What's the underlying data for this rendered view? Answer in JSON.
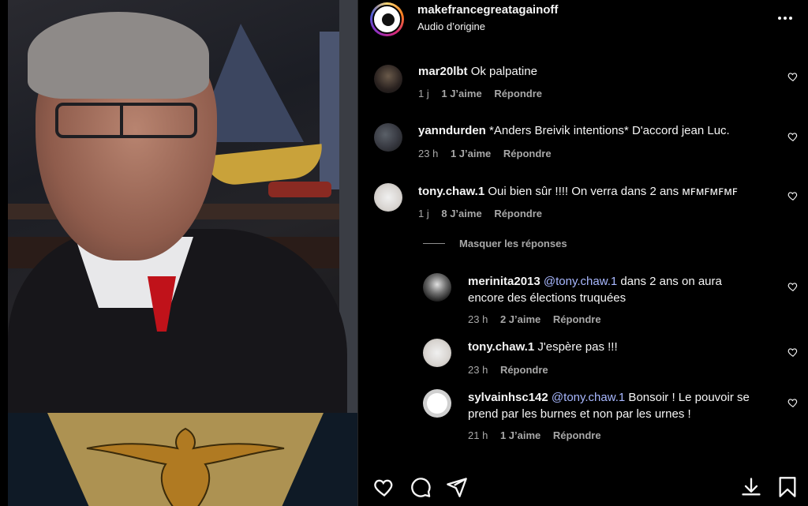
{
  "post": {
    "username": "makefrancegreatagainoff",
    "audio": "Audio d’origine"
  },
  "comments": [
    {
      "username": "mar20lbt",
      "text": "Ok palpatine",
      "time": "1 j",
      "likes": "1 J’aime",
      "reply": "Répondre"
    },
    {
      "username": "yanndurden",
      "text": "*Anders Breivik intentions* D'accord jean Luc.",
      "time": "23 h",
      "likes": "1 J’aime",
      "reply": "Répondre"
    },
    {
      "username": "tony.chaw.1",
      "text": "Oui bien sûr !!!! On verra dans 2 ans ᴍꜰᴍꜰᴍꜰᴍꜰ",
      "time": "1 j",
      "likes": "8 J’aime",
      "reply": "Répondre"
    }
  ],
  "hide_replies_label": "Masquer les réponses",
  "replies": [
    {
      "username": "merinita2013",
      "mention": "@tony.chaw.1",
      "text_line1": " dans 2 ans on aura",
      "text_line2": "encore des élections truquées",
      "time": "23 h",
      "likes": "2 J’aime",
      "reply": "Répondre"
    },
    {
      "username": "tony.chaw.1",
      "text": "J'espère pas !!!",
      "time": "23 h",
      "reply": "Répondre"
    },
    {
      "username": "sylvainhsc142",
      "mention": "@tony.chaw.1",
      "text_line1": " Bonsoir ! Le pouvoir se",
      "text_line2": "prend par les burnes et non par les urnes !",
      "time": "21 h",
      "likes": "1 J’aime",
      "reply": "Répondre"
    }
  ],
  "icons": {
    "more": "more-options-icon",
    "like": "heart-icon",
    "comment": "comment-icon",
    "share": "send-icon",
    "download": "download-icon",
    "save": "bookmark-icon"
  },
  "colors": {
    "background": "#000000",
    "text": "#f5f5f5",
    "secondary": "#a8a8a8",
    "mention": "#a8b8ff"
  }
}
